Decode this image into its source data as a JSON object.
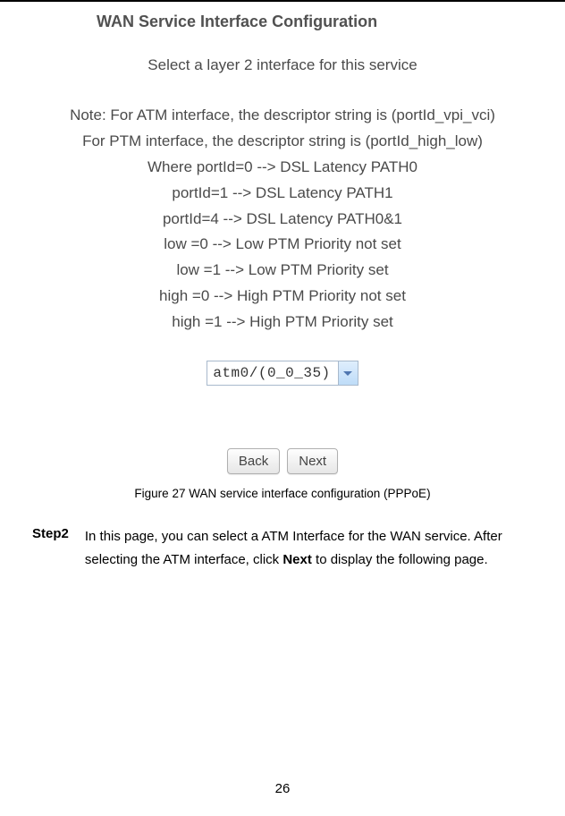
{
  "screenshot": {
    "title": "WAN Service Interface Configuration",
    "subtitle": "Select a layer 2 interface for this service",
    "note_lines": [
      "Note: For ATM interface, the descriptor string is (portId_vpi_vci)",
      "For PTM interface, the descriptor string is (portId_high_low)",
      "Where portId=0 --> DSL Latency PATH0",
      "portId=1 --> DSL Latency PATH1",
      "portId=4 --> DSL Latency PATH0&1",
      "low =0 --> Low PTM Priority not set",
      "low =1 --> Low PTM Priority set",
      "high =0 --> High PTM Priority not set",
      "high =1 --> High PTM Priority set"
    ],
    "dropdown_value": "atm0/(0_0_35)",
    "back_label": "Back",
    "next_label": "Next"
  },
  "figure_caption": "Figure 27 WAN service interface configuration (PPPoE)",
  "step": {
    "label": "Step2",
    "text_before": "In this page, you can select a ATM Interface for the WAN service. After selecting the ATM interface, click ",
    "bold": "Next",
    "text_after": " to display the following page."
  },
  "page_number": "26"
}
